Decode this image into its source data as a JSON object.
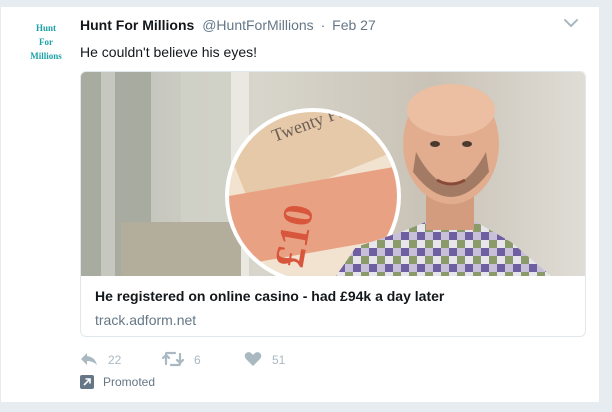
{
  "tweet": {
    "avatar_text": "Hunt\nFor\nMillions",
    "display_name": "Hunt For Millions",
    "handle": "@HuntForMillions",
    "separator": "·",
    "timestamp": "Feb 27",
    "text": "He couldn't believe his eyes!",
    "card": {
      "title": "He registered on online casino - had £94k a day later",
      "domain": "track.adform.net"
    },
    "actions": {
      "reply_count": "22",
      "retweet_count": "6",
      "like_count": "51"
    },
    "promoted_label": "Promoted"
  },
  "colors": {
    "accent": "#1da1a8",
    "secondary_text": "#657786",
    "action_icon": "#aab8c2"
  },
  "icons": [
    "chevron-down-icon",
    "reply-icon",
    "retweet-icon",
    "heart-icon",
    "promoted-icon"
  ]
}
